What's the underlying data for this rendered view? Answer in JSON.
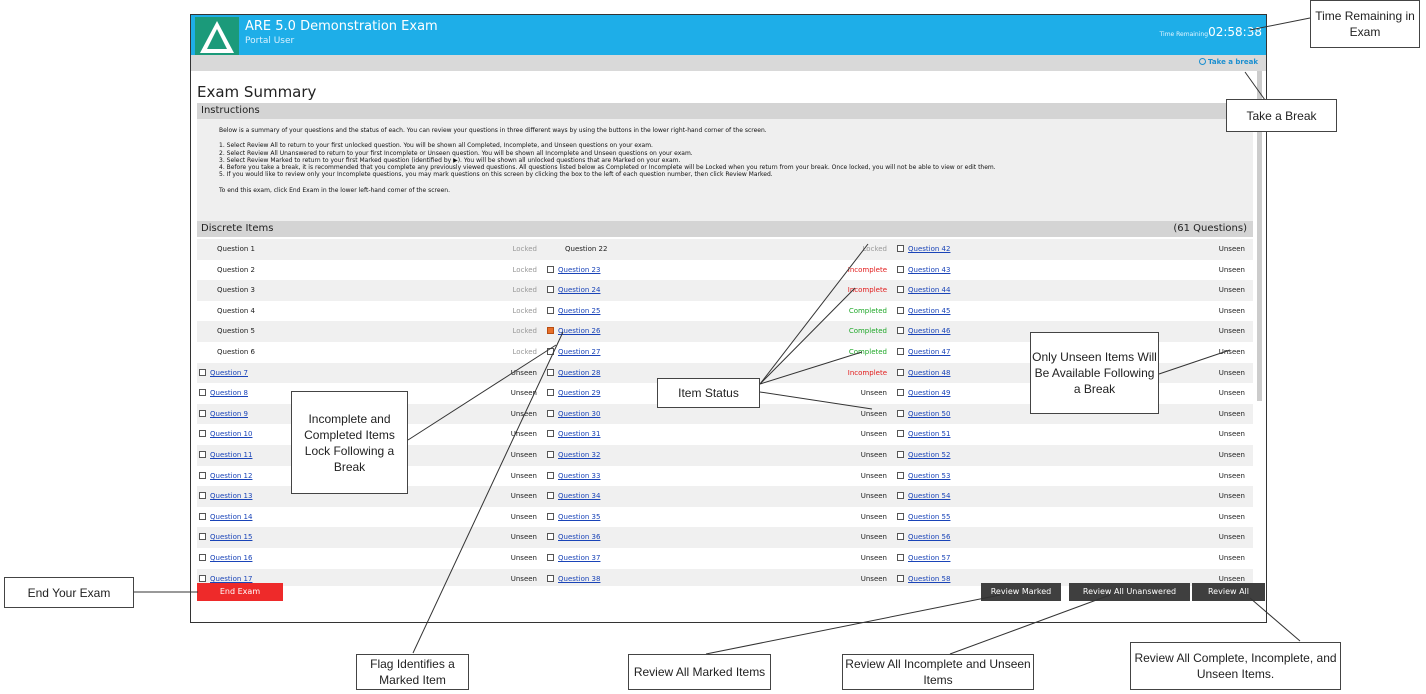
{
  "app": {
    "logo_text": "ARE 5.0",
    "title": "ARE 5.0 Demonstration Exam",
    "user": "Portal User",
    "time_label": "Time Remaining",
    "time_value": "02:58:38",
    "take_break": "Take a break"
  },
  "page_title": "Exam Summary",
  "instructions": {
    "heading": "Instructions",
    "lines": [
      "Below is a summary of your questions and the status of each. You can review your questions in three different ways by using the buttons in the lower right-hand corner of the screen.",
      "",
      "1. Select Review All to return to your first unlocked question. You will be shown all Completed, Incomplete, and Unseen questions on your exam.",
      "2. Select Review All Unanswered to return to your first Incomplete or Unseen question. You will be shown all Incomplete and Unseen questions on your exam.",
      "3. Select Review Marked to return to your first Marked question (identified by ▶). You will be shown all unlocked questions that are Marked on your exam.",
      "4. Before you take a break, it is recommended that you complete any previously viewed questions. All questions listed below as Completed or Incomplete will be Locked when you return from your break. Once locked, you will not be able to view or edit them.",
      "5. If you would like to review only your Incomplete questions, you may mark questions on this screen by clicking the box to the left of each question number, then click Review Marked.",
      "",
      "To end this exam, click End Exam in the lower left-hand corner of the screen."
    ]
  },
  "discrete": {
    "heading": "Discrete Items",
    "count": "(61 Questions)",
    "columns": [
      [
        {
          "q": "Question 1",
          "s": "Locked"
        },
        {
          "q": "Question 2",
          "s": "Locked"
        },
        {
          "q": "Question 3",
          "s": "Locked"
        },
        {
          "q": "Question 4",
          "s": "Locked"
        },
        {
          "q": "Question 5",
          "s": "Locked"
        },
        {
          "q": "Question 6",
          "s": "Locked"
        },
        {
          "q": "Question 7",
          "s": "Unseen"
        },
        {
          "q": "Question 8",
          "s": "Unseen"
        },
        {
          "q": "Question 9",
          "s": "Unseen"
        },
        {
          "q": "Question 10",
          "s": "Unseen"
        },
        {
          "q": "Question 11",
          "s": "Unseen"
        },
        {
          "q": "Question 12",
          "s": "Unseen"
        },
        {
          "q": "Question 13",
          "s": "Unseen"
        },
        {
          "q": "Question 14",
          "s": "Unseen"
        },
        {
          "q": "Question 15",
          "s": "Unseen"
        },
        {
          "q": "Question 16",
          "s": "Unseen"
        },
        {
          "q": "Question 17",
          "s": "Unseen"
        }
      ],
      [
        {
          "q": "Question 22",
          "s": "Locked"
        },
        {
          "q": "Question 23",
          "s": "Incomplete"
        },
        {
          "q": "Question 24",
          "s": "Incomplete"
        },
        {
          "q": "Question 25",
          "s": "Completed"
        },
        {
          "q": "Question 26",
          "s": "Completed",
          "flag": true
        },
        {
          "q": "Question 27",
          "s": "Completed"
        },
        {
          "q": "Question 28",
          "s": "Incomplete"
        },
        {
          "q": "Question 29",
          "s": "Unseen"
        },
        {
          "q": "Question 30",
          "s": "Unseen"
        },
        {
          "q": "Question 31",
          "s": "Unseen"
        },
        {
          "q": "Question 32",
          "s": "Unseen"
        },
        {
          "q": "Question 33",
          "s": "Unseen"
        },
        {
          "q": "Question 34",
          "s": "Unseen"
        },
        {
          "q": "Question 35",
          "s": "Unseen"
        },
        {
          "q": "Question 36",
          "s": "Unseen"
        },
        {
          "q": "Question 37",
          "s": "Unseen"
        },
        {
          "q": "Question 38",
          "s": "Unseen"
        }
      ],
      [
        {
          "q": "Question 42",
          "s": "Unseen"
        },
        {
          "q": "Question 43",
          "s": "Unseen"
        },
        {
          "q": "Question 44",
          "s": "Unseen"
        },
        {
          "q": "Question 45",
          "s": "Unseen"
        },
        {
          "q": "Question 46",
          "s": "Unseen"
        },
        {
          "q": "Question 47",
          "s": "Unseen"
        },
        {
          "q": "Question 48",
          "s": "Unseen"
        },
        {
          "q": "Question 49",
          "s": "Unseen"
        },
        {
          "q": "Question 50",
          "s": "Unseen"
        },
        {
          "q": "Question 51",
          "s": "Unseen"
        },
        {
          "q": "Question 52",
          "s": "Unseen"
        },
        {
          "q": "Question 53",
          "s": "Unseen"
        },
        {
          "q": "Question 54",
          "s": "Unseen"
        },
        {
          "q": "Question 55",
          "s": "Unseen"
        },
        {
          "q": "Question 56",
          "s": "Unseen"
        },
        {
          "q": "Question 57",
          "s": "Unseen"
        },
        {
          "q": "Question 58",
          "s": "Unseen"
        }
      ]
    ]
  },
  "buttons": {
    "end_exam": "End Exam",
    "review_marked": "Review Marked",
    "review_all_unanswered": "Review All Unanswered",
    "review_all": "Review All"
  },
  "callouts": {
    "time_remaining": "Time Remaining in Exam",
    "take_break": "Take a Break",
    "end_exam": "End Your Exam",
    "locked_items": "Incomplete and Completed Items Lock Following a Break",
    "item_status": "Item Status",
    "unseen_items": "Only Unseen Items Will Be Available Following a Break",
    "flag": "Flag Identifies a Marked Item",
    "review_marked": "Review All Marked Items",
    "review_unanswered": "Review All Incomplete and Unseen Items",
    "review_all": "Review All Complete, Incomplete, and Unseen Items."
  },
  "colors": {
    "header": "#1eaee8",
    "end_button": "#ee2a2a",
    "locked": "#999999",
    "incomplete": "#e21b1b",
    "completed": "#20a82a",
    "link": "#1a44b8"
  }
}
